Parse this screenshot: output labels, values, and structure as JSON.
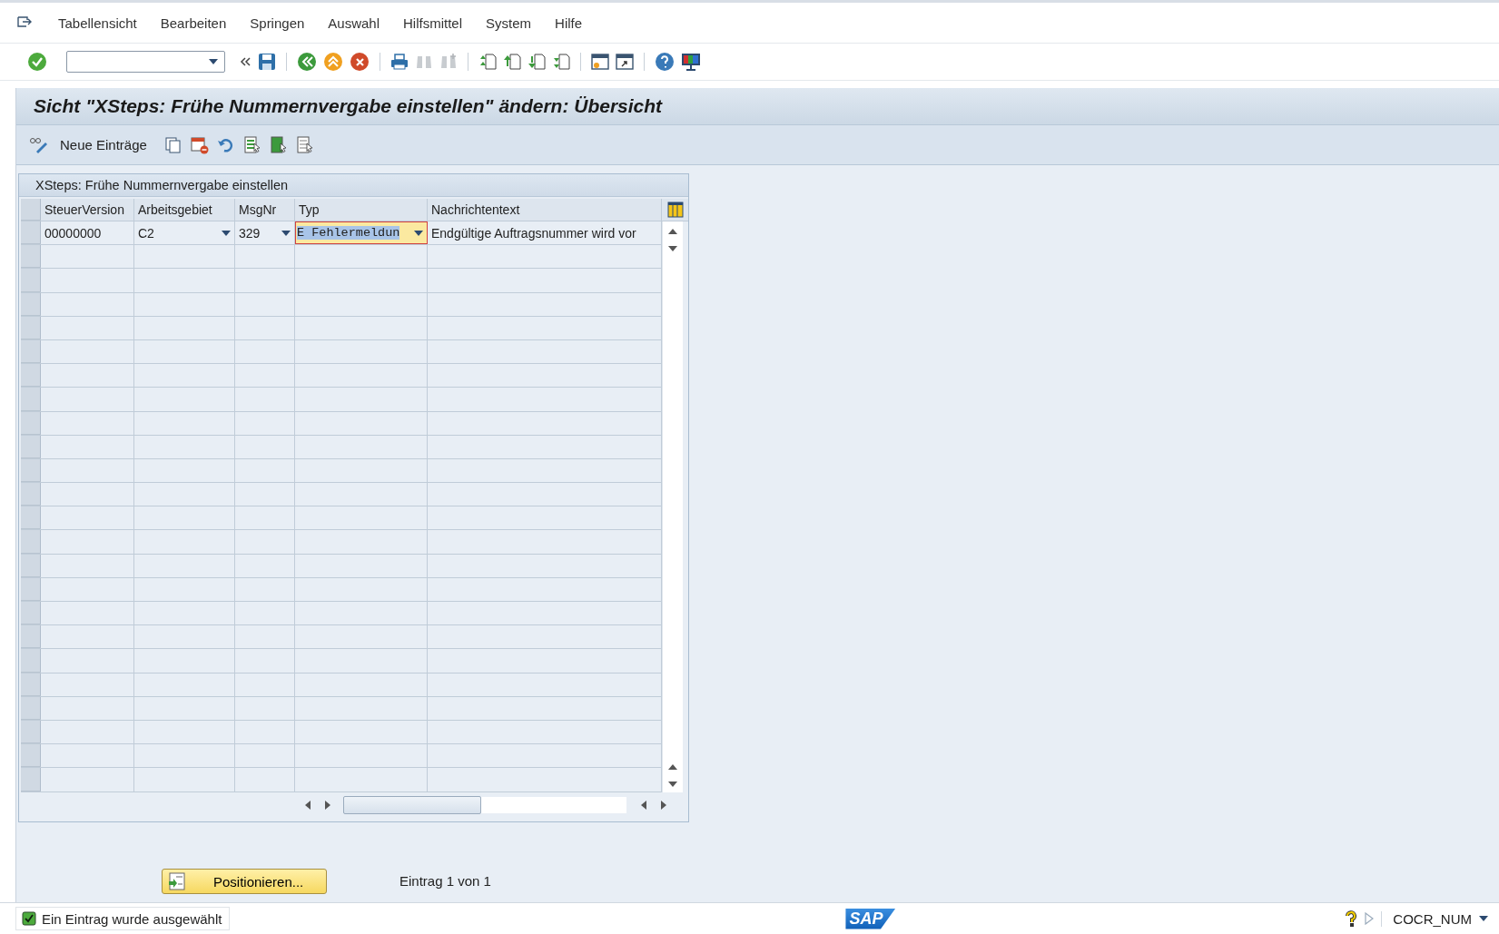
{
  "menu": [
    "Tabellensicht",
    "Bearbeiten",
    "Springen",
    "Auswahl",
    "Hilfsmittel",
    "System",
    "Hilfe"
  ],
  "title": "Sicht \"XSteps: Frühe Nummernvergabe einstellen\" ändern: Übersicht",
  "app_toolbar": {
    "new_entries": "Neue Einträge"
  },
  "table": {
    "title": "XSteps: Frühe Nummernvergabe einstellen",
    "columns": [
      "SteuerVersion",
      "Arbeitsgebiet",
      "MsgNr",
      "Typ",
      "Nachrichtentext"
    ],
    "rows": [
      {
        "cells": [
          "00000000",
          "C2",
          "329",
          "E Fehlermeldun",
          "Endgültige Auftragsnummer wird vor"
        ],
        "selected": false
      }
    ]
  },
  "position_button": "Positionieren...",
  "entry_count": "Eintrag 1 von 1",
  "status_bar": {
    "message": "Ein Eintrag wurde ausgewählt",
    "logo": "SAP",
    "system": "COCR_NUM"
  }
}
